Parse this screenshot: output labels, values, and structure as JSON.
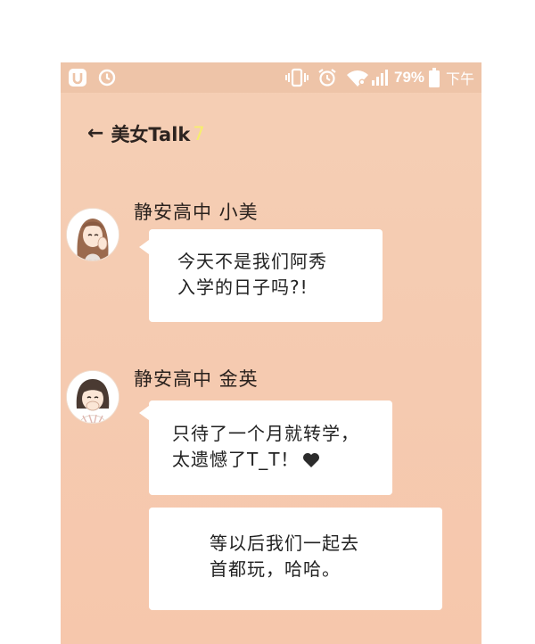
{
  "status_bar": {
    "battery": "79%",
    "time_partial": "下午",
    "icons": [
      "u-badge-icon",
      "clock-icon",
      "vibrate-icon",
      "alarm-icon",
      "wifi-icon",
      "signal-icon",
      "battery-icon"
    ]
  },
  "header": {
    "back_icon": "←",
    "title": "美女Talk",
    "count": "7"
  },
  "messages": [
    {
      "sender": "静安高中 小美",
      "avatar": "long-hair-girl-avatar",
      "lines": [
        "今天不是我们阿秀",
        "入学的日子吗?!"
      ]
    },
    {
      "sender": "静安高中 金英",
      "avatar": "short-hair-girl-avatar",
      "lines": [
        "只待了一个月就转学，",
        "太遗憾了T_T！"
      ],
      "emoji": "heart-icon"
    },
    {
      "lines": [
        "等以后我们一起去",
        "首都玩，哈哈。"
      ]
    }
  ],
  "colors": {
    "background": "#f5cdb3",
    "status_bar": "#eec4a8",
    "bubble": "#ffffff",
    "count_accent": "#f6ef6c",
    "text": "#2a221e"
  }
}
